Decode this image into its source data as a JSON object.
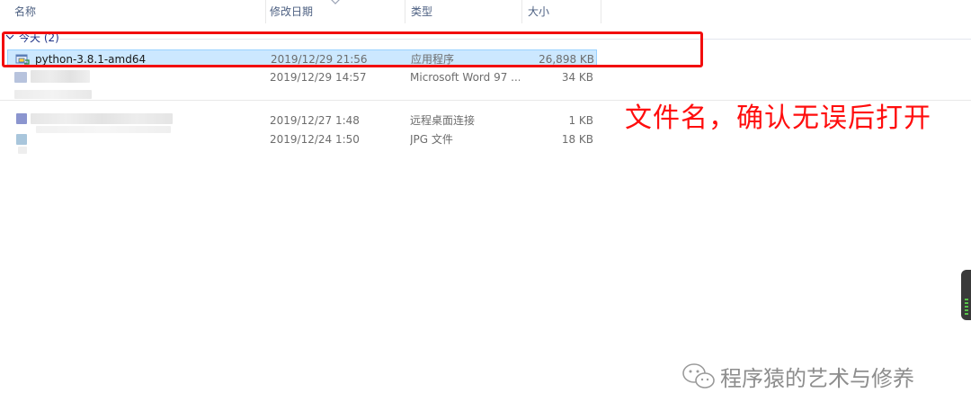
{
  "columns": {
    "name": "名称",
    "date": "修改日期",
    "type": "类型",
    "size": "大小"
  },
  "group": {
    "label": "今天 (2)"
  },
  "files": [
    {
      "name": "python-3.8.1-amd64",
      "date": "2019/12/29 21:56",
      "type": "应用程序",
      "size": "26,898 KB",
      "icon": "installer-icon",
      "selected": true
    },
    {
      "name": "",
      "date": "2019/12/29 14:57",
      "type": "Microsoft Word 97 ...",
      "size": "34 KB",
      "icon": "word-doc-icon",
      "selected": false
    },
    {
      "name": "",
      "date": "2019/12/27 1:48",
      "type": "远程桌面连接",
      "size": "1 KB",
      "icon": "rdp-icon",
      "selected": false
    },
    {
      "name": "",
      "date": "2019/12/24 1:50",
      "type": "JPG 文件",
      "size": "18 KB",
      "icon": "jpg-icon",
      "selected": false
    }
  ],
  "annotation": {
    "text": "文件名，确认无误后打开",
    "color": "#ff0d0d"
  },
  "watermark": {
    "text": "程序猿的艺术与修养",
    "icon": "wechat-icon"
  },
  "colors": {
    "selection": "#cce8ff",
    "selection_border": "#99d1ff",
    "header_text": "#4d6082",
    "group_text": "#1e3287",
    "highlight_box": "#f20d0d"
  }
}
